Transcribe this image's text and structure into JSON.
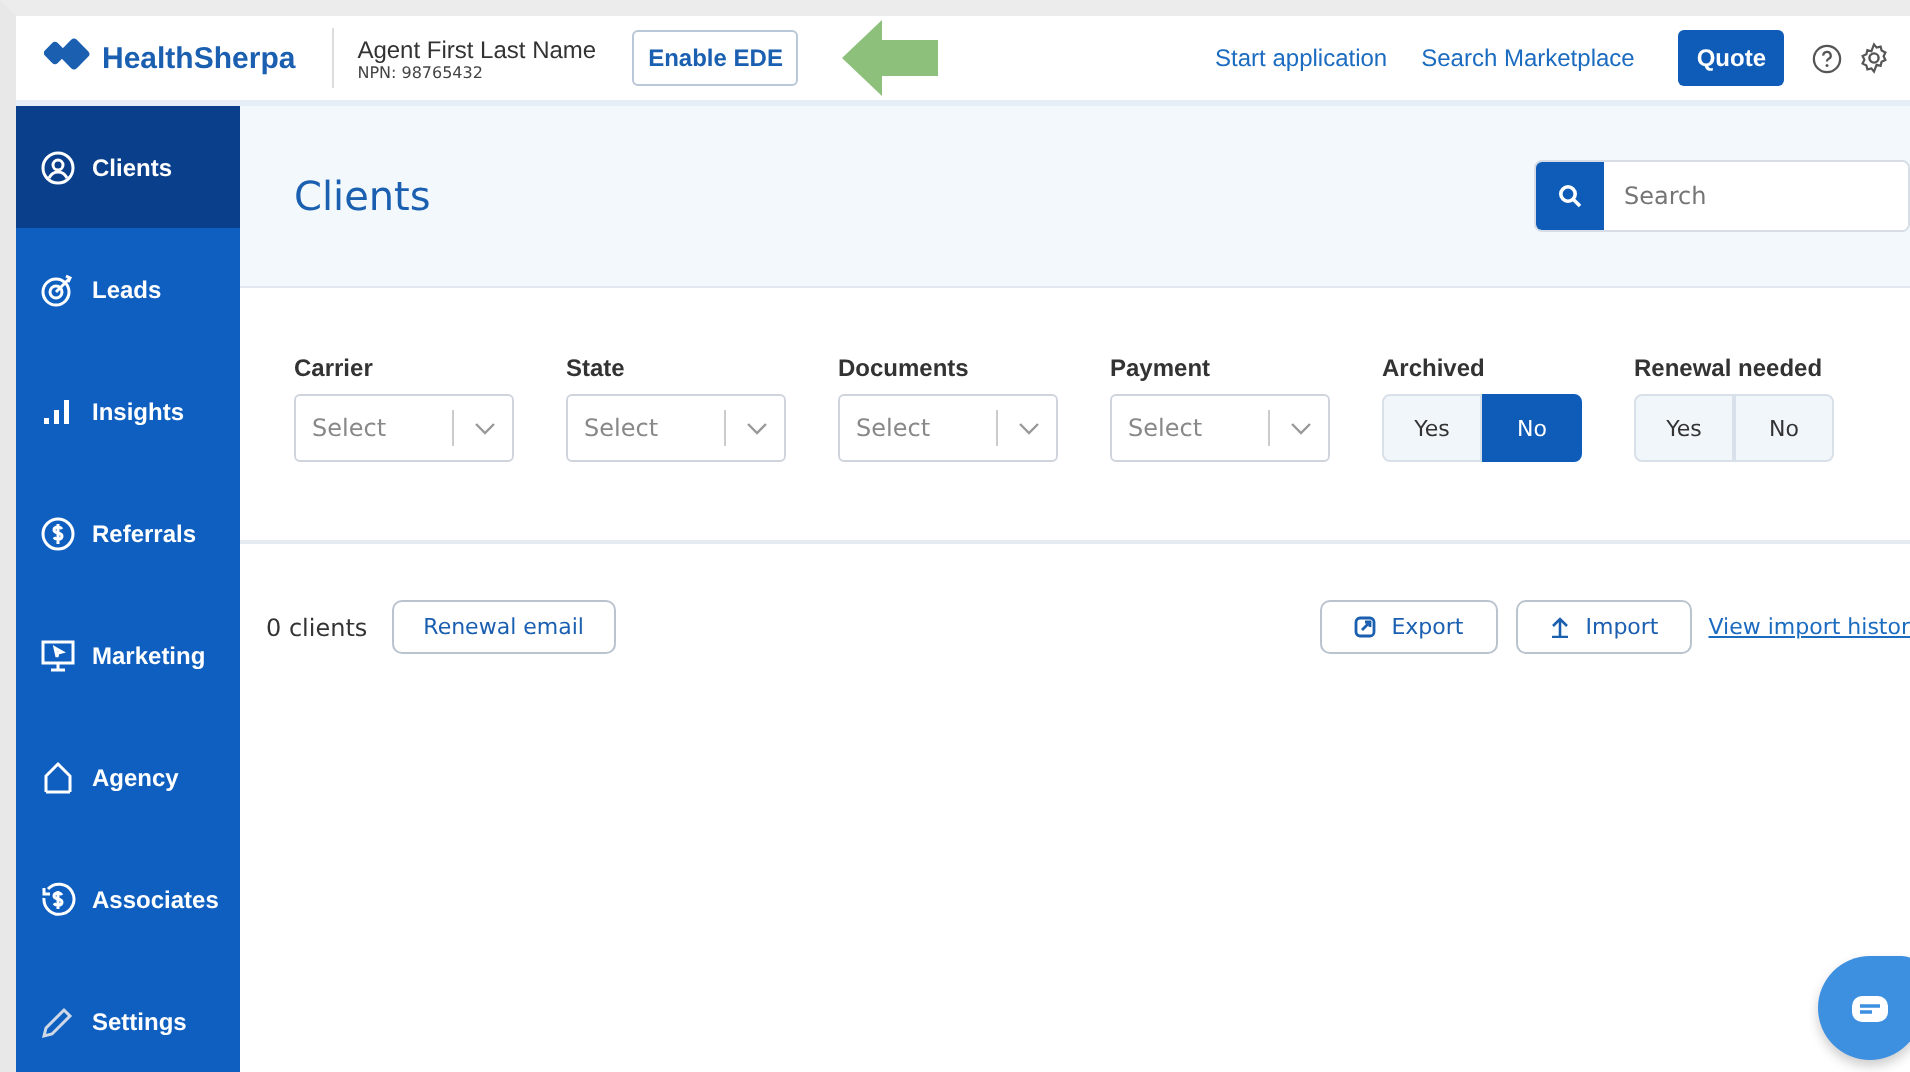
{
  "header": {
    "logo": "HealthSherpa",
    "agent_name": "Agent First Last Name",
    "npn": "NPN: 98765432",
    "enable_button": "Enable EDE",
    "links": [
      "Start application",
      "Search Marketplace"
    ],
    "quote_button": "Quote"
  },
  "sidebar": {
    "items": [
      {
        "label": "Clients",
        "selected": true
      },
      {
        "label": "Leads",
        "selected": false
      },
      {
        "label": "Insights",
        "selected": false
      },
      {
        "label": "Referrals",
        "selected": false
      },
      {
        "label": "Marketing",
        "selected": false
      },
      {
        "label": "Agency",
        "selected": false
      },
      {
        "label": "Associates",
        "selected": false
      },
      {
        "label": "Settings",
        "selected": false
      }
    ]
  },
  "page": {
    "title": "Clients",
    "search": {
      "placeholder": "Search"
    }
  },
  "filters": [
    {
      "kind": "select",
      "label": "Carrier",
      "placeholder": "Select"
    },
    {
      "kind": "select",
      "label": "State",
      "placeholder": "Select"
    },
    {
      "kind": "select",
      "label": "Documents",
      "placeholder": "Select"
    },
    {
      "kind": "select",
      "label": "Payment",
      "placeholder": "Select"
    },
    {
      "kind": "toggle",
      "label": "Archived",
      "options": [
        {
          "label": "Yes",
          "selected": false
        },
        {
          "label": "No",
          "selected": true
        }
      ]
    },
    {
      "kind": "toggle",
      "label": "Renewal needed",
      "options": [
        {
          "label": "Yes",
          "selected": false
        },
        {
          "label": "No",
          "selected": false
        }
      ]
    }
  ],
  "toolbar": {
    "count": "0 clients",
    "renewal_button": "Renewal email",
    "export_button": "Export",
    "import_button": "Import",
    "history_link": "View import histor"
  }
}
